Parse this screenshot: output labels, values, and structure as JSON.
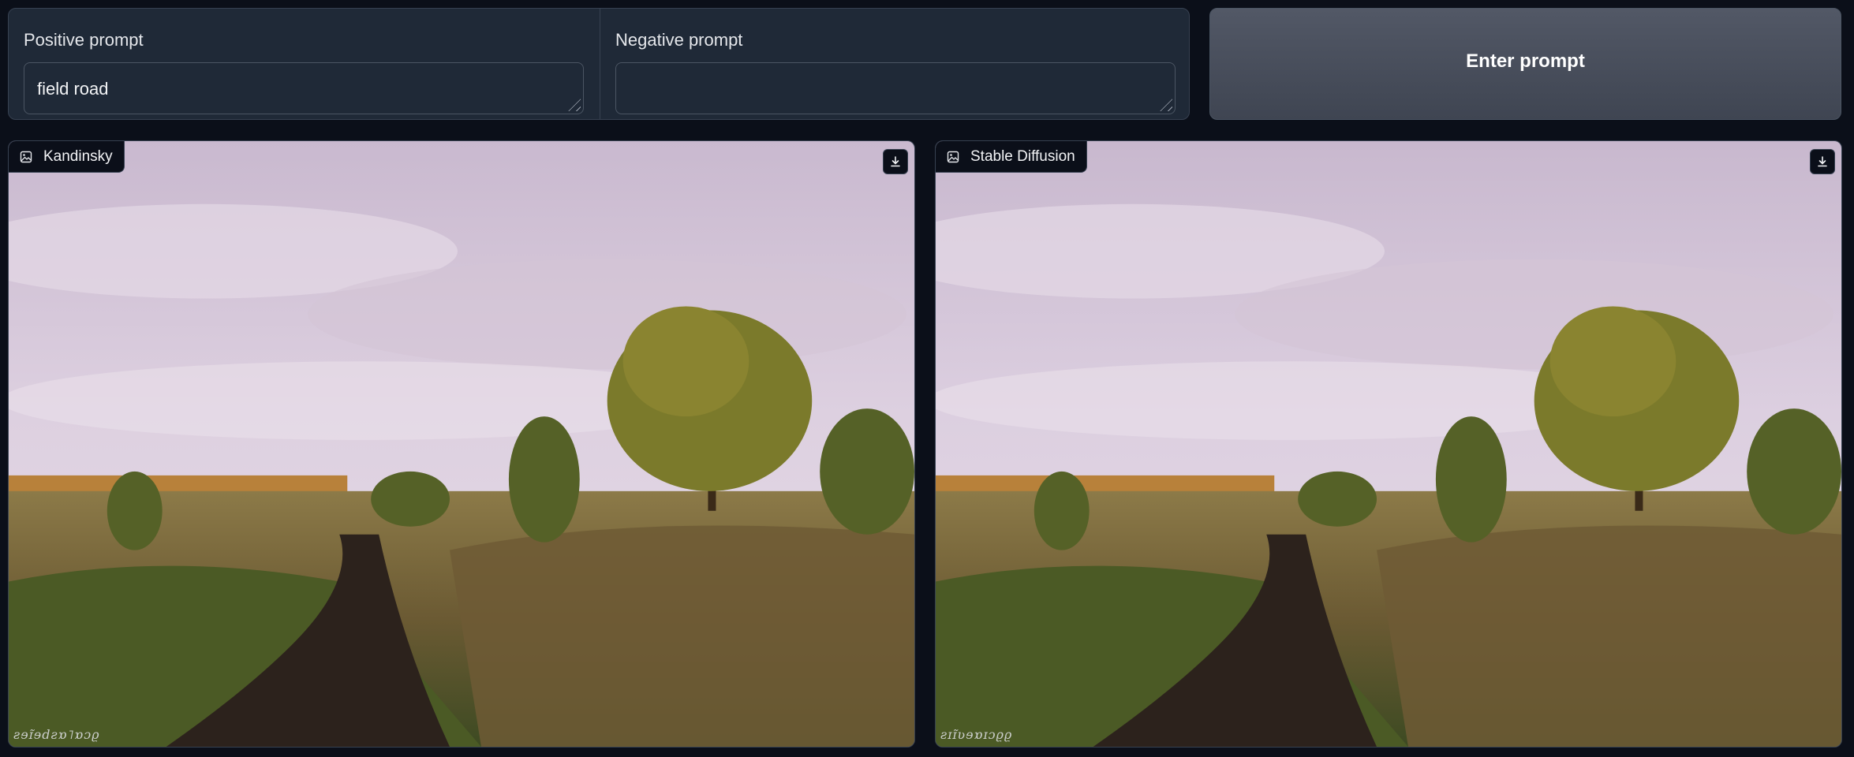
{
  "prompts": {
    "positive_label": "Positive prompt",
    "positive_value": "field road",
    "negative_label": "Negative prompt",
    "negative_value": ""
  },
  "actions": {
    "enter_label": "Enter prompt"
  },
  "outputs": [
    {
      "label": "Kandinsky",
      "watermark": "ƨɘɪ̃ɘdƨɒ˥ɒɔϱ"
    },
    {
      "label": "Stable Diffusion",
      "watermark": "ƨɪɪ̃ʋɘɒɪɔϱϱ"
    }
  ],
  "icons": {
    "image": "image-icon",
    "download": "download-icon",
    "resize": "resize-grip-icon"
  }
}
